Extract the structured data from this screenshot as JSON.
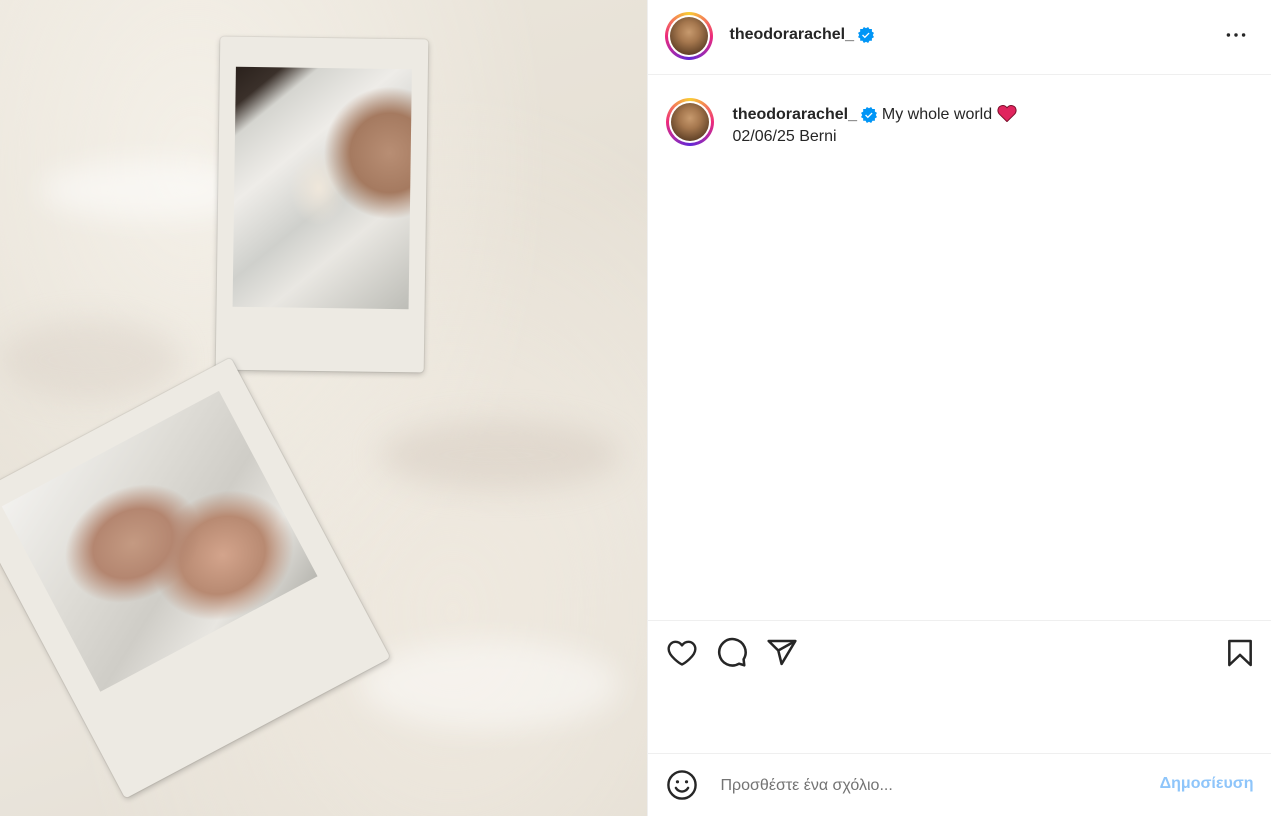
{
  "post": {
    "author": {
      "username": "theodorarachel_",
      "verified": true
    },
    "caption": {
      "text": "My whole world",
      "emoji": "heart",
      "line2": "02/06/25 Berni"
    },
    "colors": {
      "accent": "#0095f6",
      "post_button_disabled": "#8ec5fa",
      "heart_emoji": "#e0245e"
    },
    "comment": {
      "placeholder": "Προσθέστε ένα σχόλιο...",
      "post_label": "Δημοσίευση"
    },
    "icons": {
      "more": "more-horizontal-icon",
      "like": "heart-outline-icon",
      "comment": "comment-icon",
      "share": "send-icon",
      "save": "bookmark-icon",
      "emoji": "smiley-icon",
      "verified": "verified-badge-icon"
    }
  }
}
